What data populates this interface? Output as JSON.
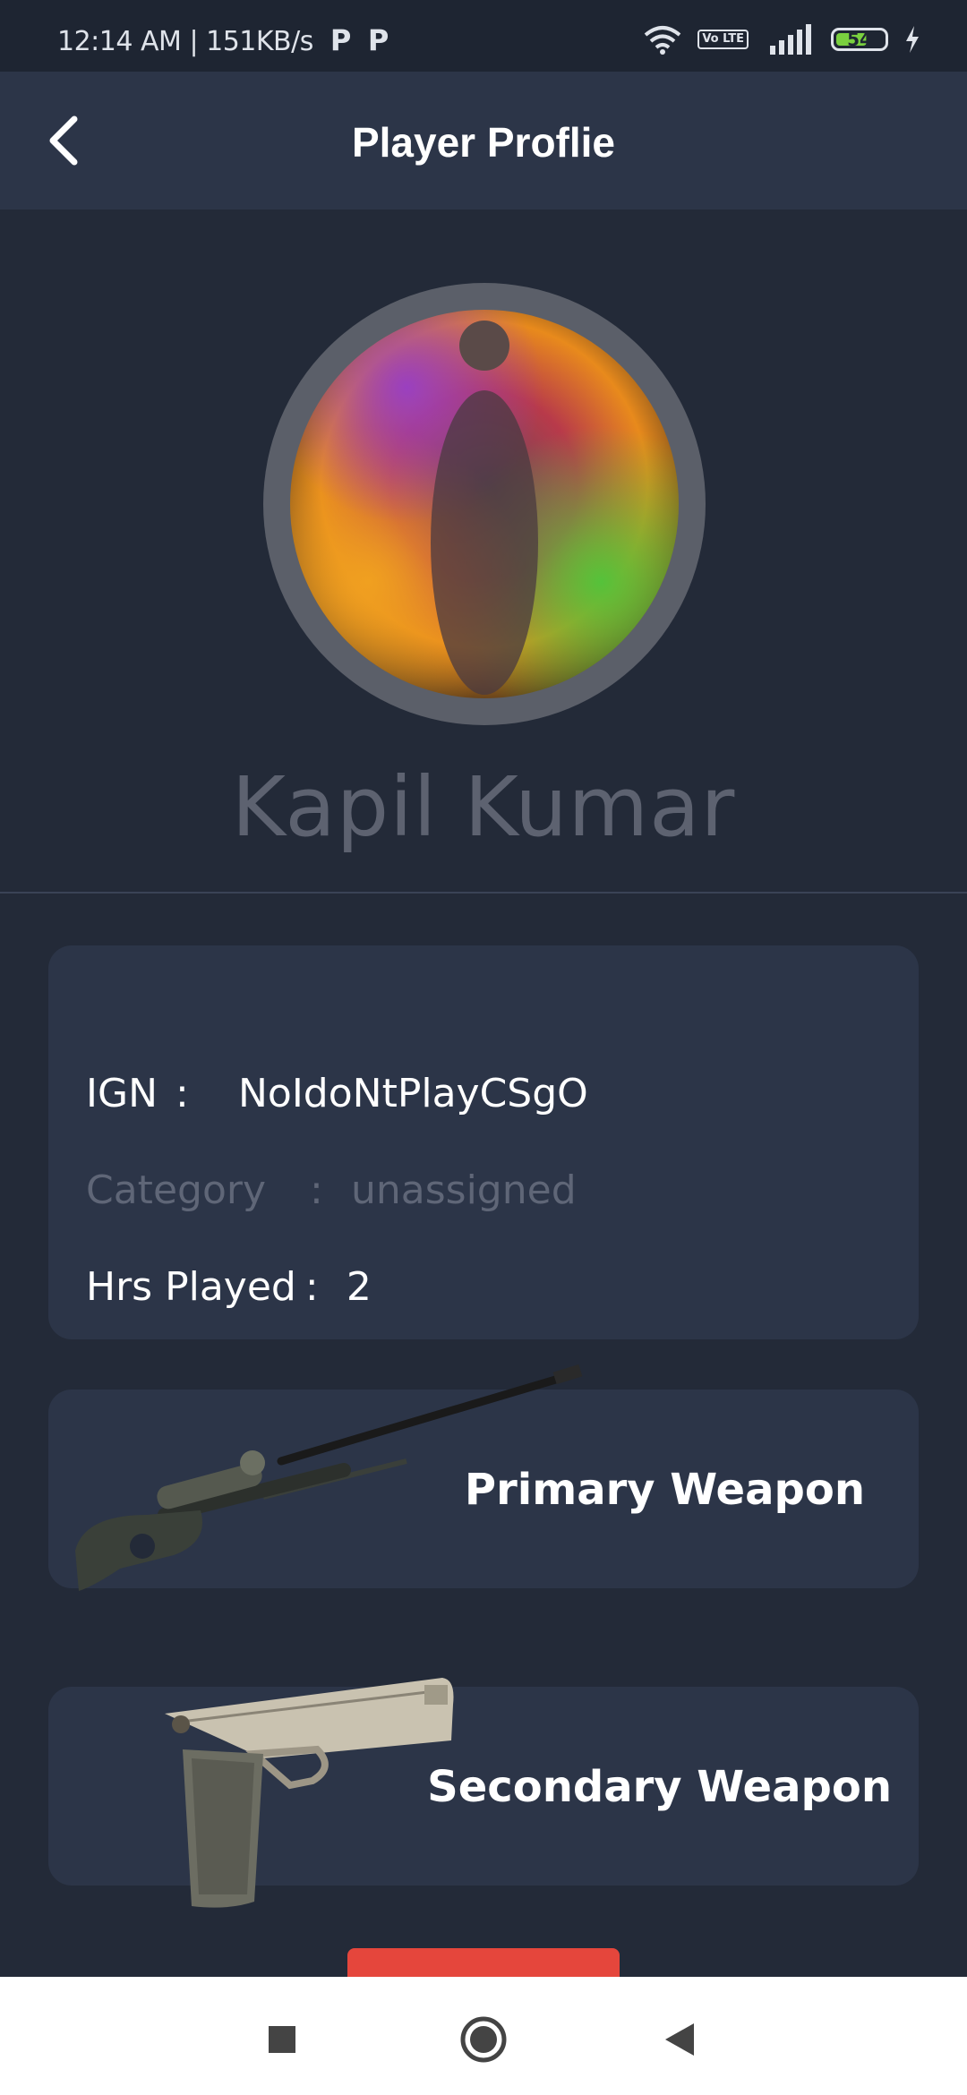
{
  "status_bar": {
    "time": "12:14 AM",
    "speed": "151KB/s",
    "notif_icons": [
      "P",
      "P"
    ],
    "lte": "Vo LTE",
    "battery": "54"
  },
  "app_bar": {
    "title": "Player Proflie"
  },
  "profile": {
    "name": "Kapil Kumar"
  },
  "info": {
    "ign_label": "IGN",
    "ign_colon": ":",
    "ign_value": "NoIdoNtPlayCSgO",
    "category_label": "Category",
    "category_colon": ":",
    "category_value": "unassigned",
    "hours_label": "Hrs Played",
    "hours_colon": ":",
    "hours_value": "2"
  },
  "weapons": {
    "primary_label": "Primary Weapon",
    "secondary_label": "Secondary Weapon"
  },
  "colors": {
    "background": "#232a38",
    "card": "#2c3548",
    "accent_red": "#e5463c"
  },
  "icons": {
    "back": "chevron-left-icon",
    "nav_recents": "square-icon",
    "nav_home": "circle-icon",
    "nav_back": "triangle-back-icon"
  }
}
